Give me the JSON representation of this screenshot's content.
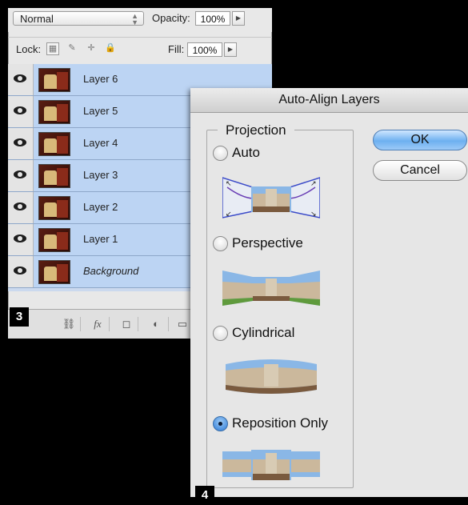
{
  "layers_panel": {
    "blend_mode": "Normal",
    "opacity_label": "Opacity:",
    "opacity_value": "100%",
    "lock_label": "Lock:",
    "fill_label": "Fill:",
    "fill_value": "100%",
    "layers": [
      {
        "name": "Layer 6",
        "visible": true,
        "italic": false
      },
      {
        "name": "Layer 5",
        "visible": true,
        "italic": false
      },
      {
        "name": "Layer 4",
        "visible": true,
        "italic": false
      },
      {
        "name": "Layer 3",
        "visible": true,
        "italic": false
      },
      {
        "name": "Layer 2",
        "visible": true,
        "italic": false
      },
      {
        "name": "Layer 1",
        "visible": true,
        "italic": false
      },
      {
        "name": "Background",
        "visible": true,
        "italic": true
      }
    ],
    "bottom_icons": [
      "link-icon",
      "fx-icon",
      "mask-icon",
      "adjustment-icon",
      "folder-icon"
    ],
    "fx_glyph": "fx",
    "figure_number": "3"
  },
  "dialog": {
    "title": "Auto-Align Layers",
    "group_label": "Projection",
    "options": [
      {
        "label": "Auto",
        "selected": false
      },
      {
        "label": "Perspective",
        "selected": false
      },
      {
        "label": "Cylindrical",
        "selected": false
      },
      {
        "label": "Reposition Only",
        "selected": true
      }
    ],
    "ok_label": "OK",
    "cancel_label": "Cancel",
    "figure_number": "4"
  },
  "colors": {
    "selection": "#bcd4f3",
    "default_button": "#6db0f0"
  }
}
